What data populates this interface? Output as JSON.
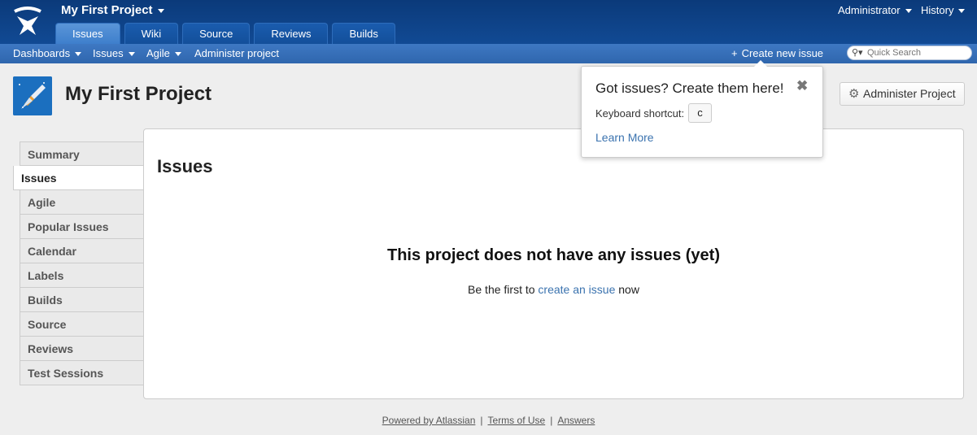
{
  "header": {
    "project_name": "My First Project",
    "tabs": [
      {
        "label": "Issues",
        "active": true
      },
      {
        "label": "Wiki",
        "active": false
      },
      {
        "label": "Source",
        "active": false
      },
      {
        "label": "Reviews",
        "active": false
      },
      {
        "label": "Builds",
        "active": false
      }
    ],
    "user": "Administrator",
    "history": "History"
  },
  "navbar": {
    "items": [
      "Dashboards",
      "Issues",
      "Agile",
      "Administer project"
    ],
    "create_issue": "Create new issue",
    "search_placeholder": "Quick Search"
  },
  "project": {
    "title": "My First Project",
    "admin_button": "Administer Project"
  },
  "sidebar": {
    "items": [
      "Summary",
      "Issues",
      "Agile",
      "Popular Issues",
      "Calendar",
      "Labels",
      "Builds",
      "Source",
      "Reviews",
      "Test Sessions"
    ],
    "active": "Issues"
  },
  "main": {
    "title": "Issues",
    "empty_heading": "This project does not have any issues (yet)",
    "empty_prefix": "Be the first to",
    "empty_link": "create an issue",
    "empty_suffix": "now"
  },
  "popup": {
    "title": "Got issues? Create them here!",
    "shortcut_label": "Keyboard shortcut:",
    "shortcut_key": "c",
    "learn_more": "Learn More"
  },
  "footer": {
    "links": [
      "Powered by Atlassian",
      "Terms of Use",
      "Answers"
    ]
  },
  "colors": {
    "header_bg": "#0b3a7a",
    "navbar_bg": "#3e78c3",
    "link": "#3b73af"
  }
}
